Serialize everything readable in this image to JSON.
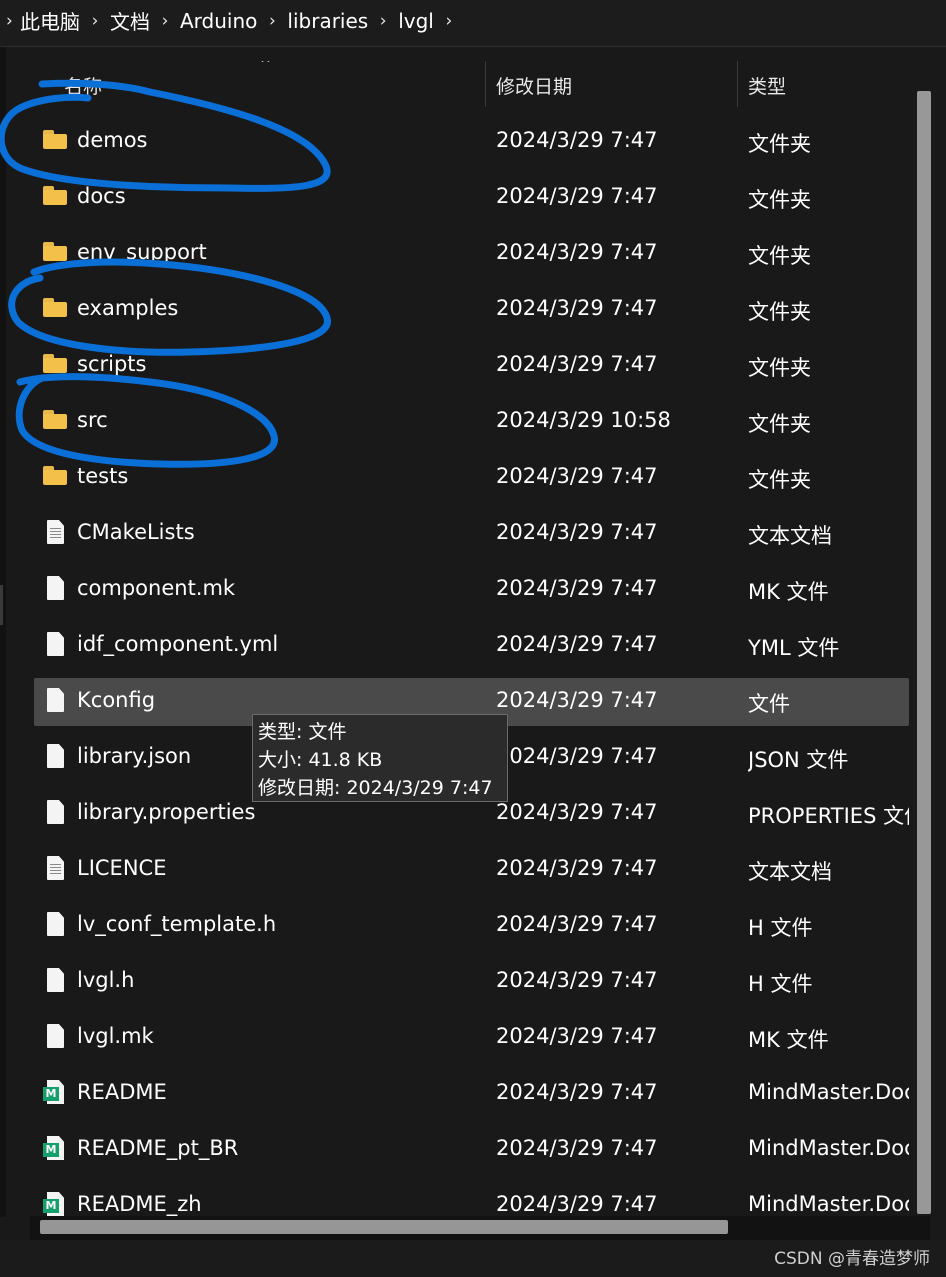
{
  "breadcrumb": [
    "此电脑",
    "文档",
    "Arduino",
    "libraries",
    "lvgl"
  ],
  "columns": {
    "name": "名称",
    "date": "修改日期",
    "type": "类型"
  },
  "rows": [
    {
      "name": "demos",
      "date": "2024/3/29 7:47",
      "type": "文件夹",
      "icon": "folder-icon"
    },
    {
      "name": "docs",
      "date": "2024/3/29 7:47",
      "type": "文件夹",
      "icon": "folder-icon"
    },
    {
      "name": "env_support",
      "date": "2024/3/29 7:47",
      "type": "文件夹",
      "icon": "folder-icon"
    },
    {
      "name": "examples",
      "date": "2024/3/29 7:47",
      "type": "文件夹",
      "icon": "folder-icon"
    },
    {
      "name": "scripts",
      "date": "2024/3/29 7:47",
      "type": "文件夹",
      "icon": "folder-icon"
    },
    {
      "name": "src",
      "date": "2024/3/29 10:58",
      "type": "文件夹",
      "icon": "folder-icon"
    },
    {
      "name": "tests",
      "date": "2024/3/29 7:47",
      "type": "文件夹",
      "icon": "folder-icon"
    },
    {
      "name": "CMakeLists",
      "date": "2024/3/29 7:47",
      "type": "文本文档",
      "icon": "text-file-icon"
    },
    {
      "name": "component.mk",
      "date": "2024/3/29 7:47",
      "type": "MK 文件",
      "icon": "file-icon"
    },
    {
      "name": "idf_component.yml",
      "date": "2024/3/29 7:47",
      "type": "YML 文件",
      "icon": "file-icon"
    },
    {
      "name": "Kconfig",
      "date": "2024/3/29 7:47",
      "type": "文件",
      "icon": "file-icon",
      "selected": true
    },
    {
      "name": "library.json",
      "date": "2024/3/29 7:47",
      "type": "JSON 文件",
      "icon": "file-icon"
    },
    {
      "name": "library.properties",
      "date": "2024/3/29 7:47",
      "type": "PROPERTIES 文件",
      "icon": "file-icon"
    },
    {
      "name": "LICENCE",
      "date": "2024/3/29 7:47",
      "type": "文本文档",
      "icon": "text-file-icon"
    },
    {
      "name": "lv_conf_template.h",
      "date": "2024/3/29 7:47",
      "type": "H 文件",
      "icon": "file-icon"
    },
    {
      "name": "lvgl.h",
      "date": "2024/3/29 7:47",
      "type": "H 文件",
      "icon": "file-icon"
    },
    {
      "name": "lvgl.mk",
      "date": "2024/3/29 7:47",
      "type": "MK 文件",
      "icon": "file-icon"
    },
    {
      "name": "README",
      "date": "2024/3/29 7:47",
      "type": "MindMaster.Document",
      "icon": "mindmaster-file-icon"
    },
    {
      "name": "README_pt_BR",
      "date": "2024/3/29 7:47",
      "type": "MindMaster.Document",
      "icon": "mindmaster-file-icon"
    },
    {
      "name": "README_zh",
      "date": "2024/3/29 7:47",
      "type": "MindMaster.Document",
      "icon": "mindmaster-file-icon"
    }
  ],
  "tooltip": {
    "type_line": "类型: 文件",
    "size_line": "大小: 41.8 KB",
    "date_line": "修改日期: 2024/3/29 7:47"
  },
  "watermark": "CSDN @青春造梦师",
  "annotation_color": "#0a6fd6"
}
